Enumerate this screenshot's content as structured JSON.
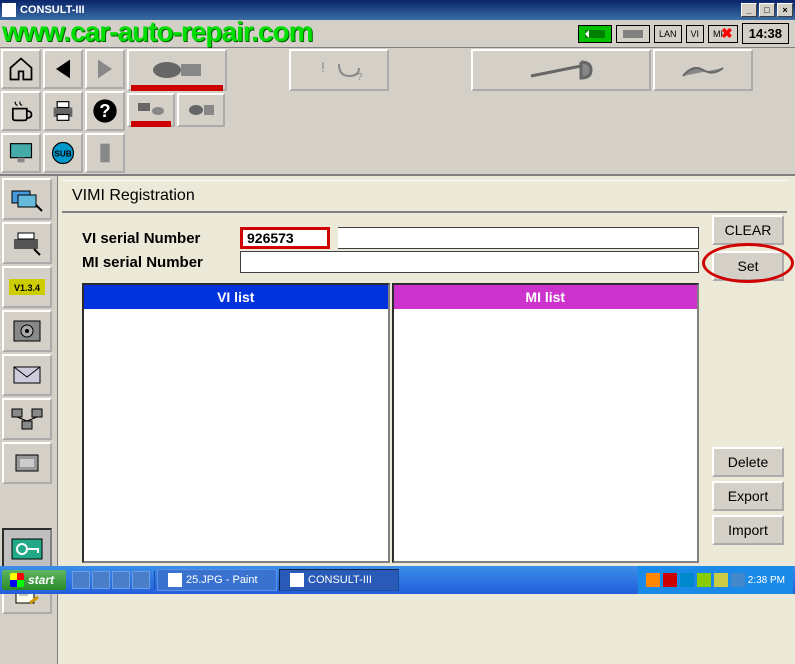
{
  "window": {
    "title": "CONSULT-III",
    "min": "_",
    "max": "□",
    "close": "×"
  },
  "watermark": "www.car-auto-repair.com",
  "status": {
    "lan": "LAN",
    "vi": "VI",
    "mi": "MI",
    "clock": "14:38"
  },
  "panel": {
    "title": "VIMI Registration",
    "vi_label": "VI serial Number",
    "mi_label": "MI serial Number",
    "vi_value": "926573",
    "mi_value": "",
    "vi_list_header": "VI list",
    "mi_list_header": "MI list"
  },
  "buttons": {
    "clear": "CLEAR",
    "set": "Set",
    "delete": "Delete",
    "export": "Export",
    "import": "Import"
  },
  "sidebar": {
    "version": "V1.3.4",
    "sub": "SUB"
  },
  "taskbar": {
    "start": "start",
    "task1": "25.JPG - Paint",
    "task2": "CONSULT-III",
    "tray_time": "2:38 PM"
  }
}
